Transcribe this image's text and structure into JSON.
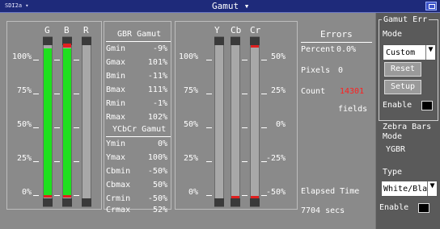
{
  "window": {
    "source": "SDI2a",
    "title": "Gamut"
  },
  "gbr_meter": {
    "columns": [
      "G",
      "B",
      "R"
    ],
    "scale": [
      "100%",
      "75%",
      "50%",
      "25%",
      "0%"
    ],
    "levels": {
      "G": 1.0,
      "B": 1.0,
      "R": 0.0
    }
  },
  "gbr_gamut": {
    "title": "GBR Gamut",
    "rows": [
      {
        "label": "Gmin",
        "value": "-9%"
      },
      {
        "label": "Gmax",
        "value": "101%"
      },
      {
        "label": "Bmin",
        "value": "-11%"
      },
      {
        "label": "Bmax",
        "value": "111%"
      },
      {
        "label": "Rmin",
        "value": "-1%"
      },
      {
        "label": "Rmax",
        "value": "102%"
      }
    ]
  },
  "ycbcr_gamut": {
    "title": "YCbCr Gamut",
    "rows": [
      {
        "label": "Ymin",
        "value": "0%"
      },
      {
        "label": "Ymax",
        "value": "100%"
      },
      {
        "label": "Cbmin",
        "value": "-50%"
      },
      {
        "label": "Cbmax",
        "value": "50%"
      },
      {
        "label": "Crmin",
        "value": "-50%"
      },
      {
        "label": "Crmax",
        "value": "52%"
      }
    ]
  },
  "ycbcr_meter": {
    "columns": [
      "Y",
      "Cb",
      "Cr"
    ],
    "left_scale": [
      "100%",
      "75%",
      "50%",
      "25%",
      "0%"
    ],
    "right_scale": [
      "50%",
      "25%",
      "0%",
      "-25%",
      "-50%"
    ]
  },
  "errors": {
    "title": "Errors",
    "percent_label": "Percent",
    "percent_value": "0.0%",
    "pixels_label": "Pixels",
    "pixels_value": "0",
    "count_label": "Count",
    "count_value": "14301",
    "count_unit": "fields",
    "count_color": "#ff2020",
    "elapsed_label": "Elapsed Time",
    "elapsed_value": "7704 secs"
  },
  "side_panel": {
    "gamut_err_title": "Gamut Err",
    "mode_label": "Mode",
    "mode_value": "Custom",
    "reset_label": "Reset",
    "setup_label": "Setup",
    "enable_label": "Enable",
    "zebra_title": "Zebra Bars",
    "zebra_mode_label": "Mode",
    "zebra_mode_value": "YGBR",
    "type_label": "Type",
    "type_value": "White/Bla",
    "zebra_enable_label": "Enable"
  }
}
